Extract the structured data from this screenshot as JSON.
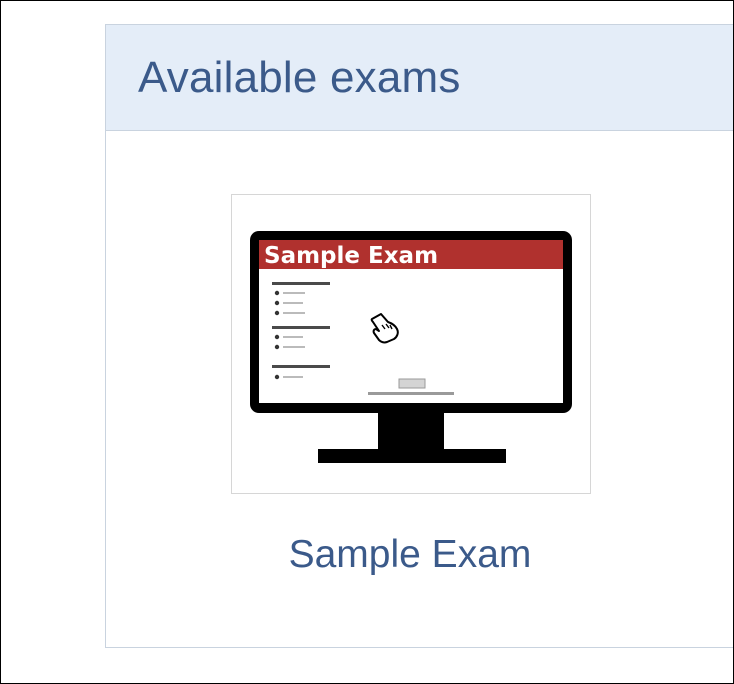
{
  "panel": {
    "title": "Available exams"
  },
  "exams": [
    {
      "name": "Sample Exam",
      "thumbnail_banner": "Sample Exam"
    }
  ],
  "colors": {
    "header_bg": "#e4edf8",
    "title_text": "#3b5a8a",
    "banner_red": "#b0312e",
    "monitor_black": "#000000"
  },
  "icons": {
    "monitor": "computer-monitor-icon",
    "pointer": "hand-pointer-icon"
  }
}
